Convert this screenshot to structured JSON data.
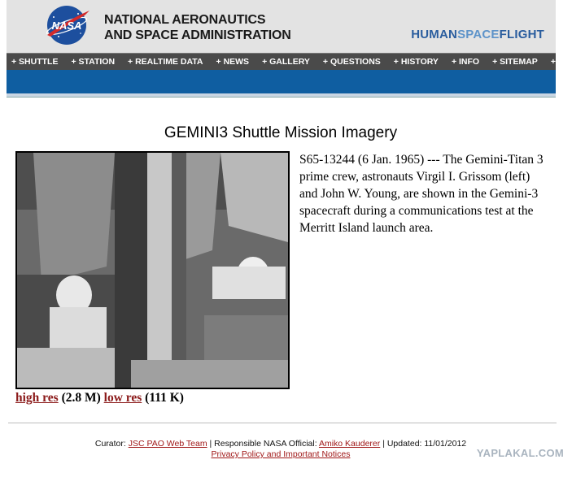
{
  "header": {
    "agency_line1": "NATIONAL AERONAUTICS",
    "agency_line2": "AND SPACE ADMINISTRATION",
    "logo_text": "NASA",
    "hsf_bold": "HUMAN",
    "hsf_light": "SPACE",
    "hsf_bold2": "FLIGHT"
  },
  "nav": {
    "items": [
      "+ SHUTTLE",
      "+ STATION",
      "+ REALTIME DATA",
      "+ NEWS",
      "+ GALLERY",
      "+ QUESTIONS",
      "+ HISTORY",
      "+ INFO",
      "+ SITEMAP",
      "+ SEARCH"
    ]
  },
  "main": {
    "title": "GEMINI3 Shuttle Mission Imagery",
    "caption": "S65-13244 (6 Jan. 1965) --- The Gemini-Titan 3 prime crew, astronauts Virgil I. Grissom (left) and John W. Young, are shown in the Gemini-3 spacecraft during a communications test at the Merritt Island launch area.",
    "high_res_label": "high res",
    "high_res_size": "(2.8 M)",
    "low_res_label": "low res",
    "low_res_size": "(111 K)"
  },
  "footer": {
    "curator_label": "Curator:",
    "curator_link": "JSC PAO Web Team",
    "official_label": "| Responsible NASA Official:",
    "official_link": "Amiko Kauderer",
    "updated": "| Updated: 11/01/2012",
    "privacy_link": "Privacy Policy and Important Notices"
  },
  "watermark": "YAPLAKAL.COM",
  "colors": {
    "nav_bg": "#4a4a4a",
    "blue_bar": "#0f5ea1",
    "link": "#8b1a1a",
    "hsf_blue": "#2a5d9e"
  }
}
